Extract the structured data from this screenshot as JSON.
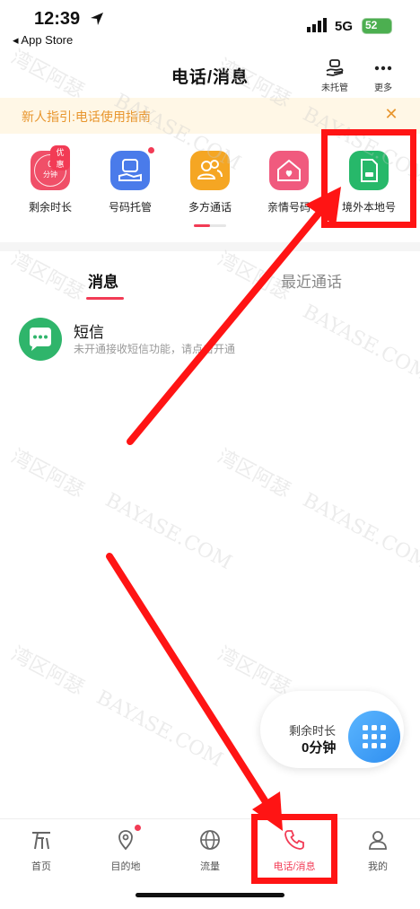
{
  "status_bar": {
    "time": "12:39",
    "back_label": "◂ App Store",
    "network": "5G",
    "battery": "52"
  },
  "header": {
    "title": "电话/消息",
    "not_hosted_label": "未托管",
    "more_label": "更多"
  },
  "guide_banner": {
    "text": "新人指引:电话使用指南",
    "close": "✕"
  },
  "features": [
    {
      "label": "剩余时长",
      "badge": "优惠",
      "value": "0",
      "unit": "分钟",
      "color": "#f04f68"
    },
    {
      "label": "号码托管",
      "color": "#4a7bea"
    },
    {
      "label": "多方通话",
      "color": "#f5a623"
    },
    {
      "label": "亲情号码",
      "color": "#f05a7e"
    },
    {
      "label": "境外本地号",
      "color": "#27b86a"
    }
  ],
  "tabs": [
    {
      "label": "消息",
      "active": true
    },
    {
      "label": "最近通话",
      "active": false
    }
  ],
  "sms": {
    "title": "短信",
    "subtitle": "未开通接收短信功能，请点击开通"
  },
  "floating": {
    "label": "剩余时长",
    "value": "0分钟"
  },
  "watermark": {
    "cn": "湾区阿瑟",
    "en": "BAYASE.COM"
  },
  "bottom_nav": [
    {
      "label": "首页",
      "icon": "home-icon"
    },
    {
      "label": "目的地",
      "icon": "location-pin-icon"
    },
    {
      "label": "流量",
      "icon": "globe-icon"
    },
    {
      "label": "电话/消息",
      "icon": "phone-icon",
      "active": true
    },
    {
      "label": "我的",
      "icon": "person-icon"
    }
  ],
  "colors": {
    "accent": "#f23b55",
    "annotation": "#ff1414",
    "banner_bg": "#fff7e6",
    "banner_text": "#e8962e"
  }
}
